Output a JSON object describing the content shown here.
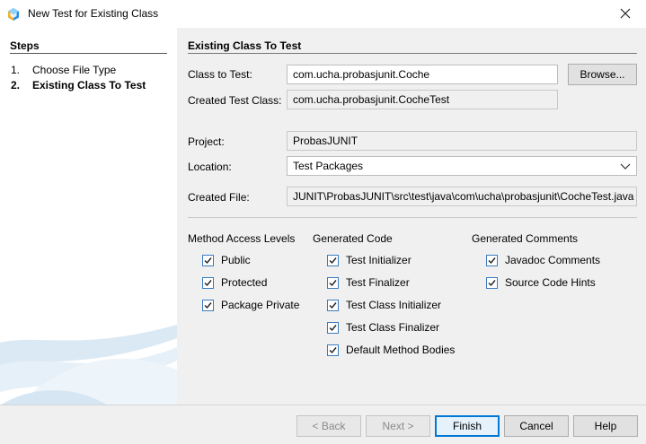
{
  "window": {
    "title": "New Test for Existing Class"
  },
  "steps": {
    "title": "Steps",
    "items": [
      {
        "num": "1.",
        "label": "Choose File Type"
      },
      {
        "num": "2.",
        "label": "Existing Class To Test"
      }
    ]
  },
  "panel": {
    "title": "Existing Class To Test",
    "class_to_test": {
      "label": "Class to Test:",
      "value": "com.ucha.probasjunit.Coche",
      "browse": "Browse..."
    },
    "created_test_class": {
      "label": "Created Test Class:",
      "value": "com.ucha.probasjunit.CocheTest"
    },
    "project": {
      "label": "Project:",
      "value": "ProbasJUNIT"
    },
    "location": {
      "label": "Location:",
      "value": "Test Packages"
    },
    "created_file": {
      "label": "Created File:",
      "value": "JUNIT\\ProbasJUNIT\\src\\test\\java\\com\\ucha\\probasjunit\\CocheTest.java"
    }
  },
  "options": {
    "access": {
      "title": "Method Access Levels",
      "items": [
        {
          "label": "Public",
          "checked": true
        },
        {
          "label": "Protected",
          "checked": true
        },
        {
          "label": "Package Private",
          "checked": true
        }
      ]
    },
    "code": {
      "title": "Generated Code",
      "items": [
        {
          "label": "Test Initializer",
          "checked": true
        },
        {
          "label": "Test Finalizer",
          "checked": true
        },
        {
          "label": "Test Class Initializer",
          "checked": true
        },
        {
          "label": "Test Class Finalizer",
          "checked": true
        },
        {
          "label": "Default Method Bodies",
          "checked": true
        }
      ]
    },
    "comments": {
      "title": "Generated Comments",
      "items": [
        {
          "label": "Javadoc Comments",
          "checked": true
        },
        {
          "label": "Source Code Hints",
          "checked": true
        }
      ]
    }
  },
  "buttons": {
    "back": "< Back",
    "next": "Next >",
    "finish": "Finish",
    "cancel": "Cancel",
    "help": "Help"
  },
  "colors": {
    "accent": "#0078d7",
    "checkbox_border": "#3b7bbf",
    "check_mark": "#1f1f1f"
  }
}
